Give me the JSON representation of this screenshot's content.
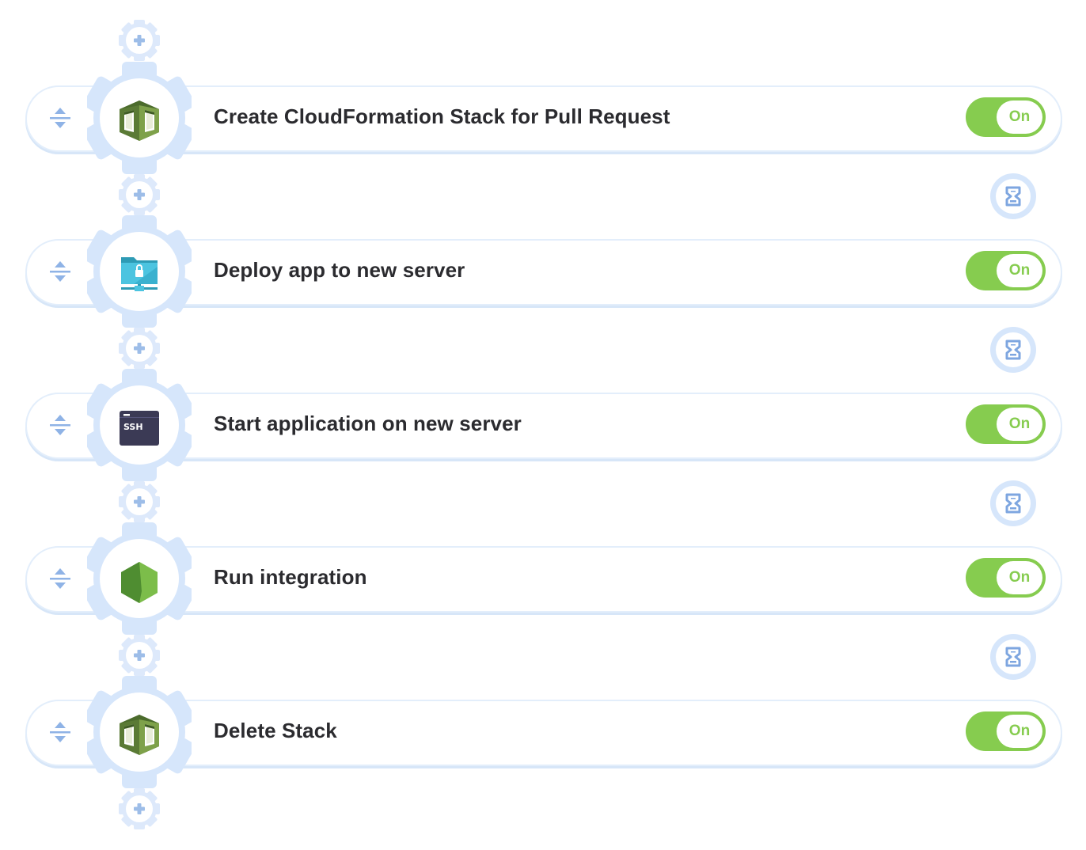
{
  "colors": {
    "accent_green": "#86cc4f",
    "gear_light_blue": "#d6e6fb",
    "icon_blue": "#8fb3e6",
    "title_text": "#2b2b2f"
  },
  "icons": {
    "add_step": "plus-gear-icon",
    "drag": "drag-handle-icon",
    "delay": "hourglass-icon"
  },
  "steps": [
    {
      "title": "Create CloudFormation Stack for Pull Request",
      "icon": "aws-cloudformation-icon",
      "toggle_label": "On",
      "enabled": true
    },
    {
      "title": "Deploy app to new server",
      "icon": "sftp-deploy-icon",
      "toggle_label": "On",
      "enabled": true
    },
    {
      "title": "Start application on new server",
      "icon": "ssh-terminal-icon",
      "toggle_label": "On",
      "enabled": true,
      "icon_text": "SSH"
    },
    {
      "title": "Run integration",
      "icon": "nodejs-icon",
      "toggle_label": "On",
      "enabled": true
    },
    {
      "title": "Delete Stack",
      "icon": "aws-cloudformation-icon",
      "toggle_label": "On",
      "enabled": true
    }
  ]
}
